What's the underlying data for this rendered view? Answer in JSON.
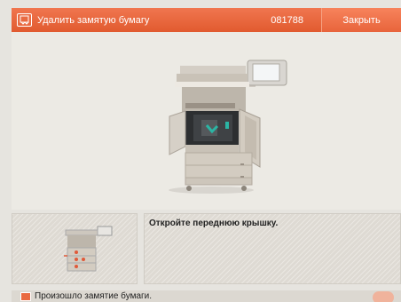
{
  "header": {
    "title": "Удалить замятую бумагу",
    "code": "081788",
    "close_label": "Закрыть"
  },
  "instruction": {
    "text": "Откройте переднюю крышку."
  },
  "status": {
    "text": "Произошло замятие бумаги."
  },
  "colors": {
    "header": "#e15a2f",
    "accent_green": "#2bb5a4",
    "jam_marker": "#e05a3a"
  },
  "icons": [
    "paper-jam-icon",
    "printer-illustration",
    "printer-thumbnail"
  ]
}
